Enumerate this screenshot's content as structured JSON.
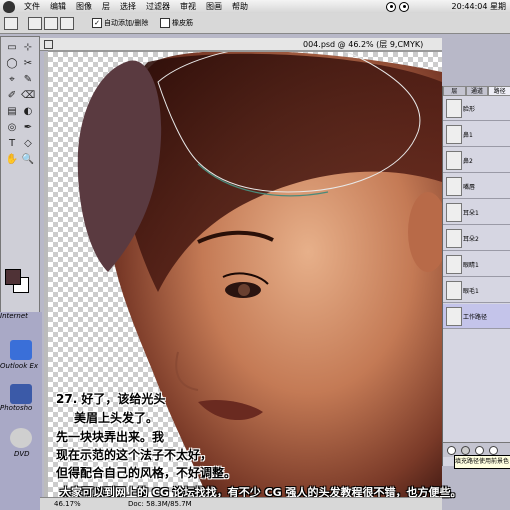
{
  "menubar": {
    "items": [
      "文件",
      "编辑",
      "图像",
      "层",
      "选择",
      "过滤器",
      "审视",
      "图画",
      "帮助"
    ],
    "clock": "20:44:04 星期"
  },
  "options": {
    "auto_add_label": "自动添加/删除",
    "rubber_band_label": "橡皮筋"
  },
  "document": {
    "title": "004.psd @ 46.2% (层 9,CMYK)",
    "zoom": "46.17%",
    "doc_size": "Doc: 58.3M/85.7M"
  },
  "panel": {
    "tabs": [
      "层",
      "通道",
      "路径"
    ],
    "layers": [
      "脸形",
      "鼻1",
      "鼻2",
      "嘴唇",
      "耳朵1",
      "耳朵2",
      "眼睛1",
      "眼毛1",
      "工作路径"
    ],
    "selected_index": 8
  },
  "tooltip": "填充路径使用前景色",
  "desktop_icons": [
    {
      "label": "Internet",
      "color": "#5a7fc0"
    },
    {
      "label": "Outlook Ex",
      "color": "#3a6fd8"
    },
    {
      "label": "Photosho",
      "color": "#3b5aa8"
    },
    {
      "label": "DVD",
      "color": "#cfcfcf"
    }
  ],
  "tools": [
    "▭",
    "⊹",
    "◯",
    "✂",
    "⌖",
    "✎",
    "✐",
    "⌫",
    "▤",
    "◐",
    "◎",
    "✒",
    "T",
    "◇",
    "✋",
    "🔍"
  ],
  "colors": {
    "foreground": "#4f3236",
    "background": "#ffffff"
  },
  "caption": {
    "lines": [
      "27. 好了，该给光头",
      "美眉上头发了。",
      "先一块块弄出来。我",
      "现在示范的这个法子不太好，",
      "但得配合自己的风格，不好调整。"
    ],
    "bottom": "大家可以到网上的 CG 论坛找找，有不少 CG 强人的头发教程很不错，也方便些。"
  }
}
